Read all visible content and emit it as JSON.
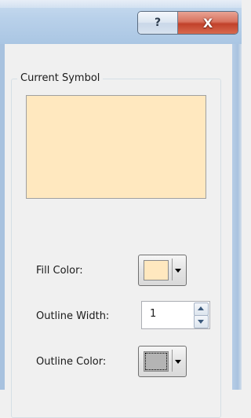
{
  "window": {
    "help_label": "?",
    "close_label": "X"
  },
  "group": {
    "title": "Current Symbol"
  },
  "symbol": {
    "preview_color": "#ffe8bf"
  },
  "fill": {
    "label": "Fill Color:",
    "color": "#ffe8bf"
  },
  "outline_width": {
    "label": "Outline Width:",
    "value": "1"
  },
  "outline_color": {
    "label": "Outline Color:",
    "color": "#b4b4b4"
  },
  "icons": {
    "help": "question-mark-icon",
    "close": "close-icon",
    "dropdown": "chevron-down-icon",
    "spin_up": "spin-up-icon",
    "spin_down": "spin-down-icon"
  }
}
